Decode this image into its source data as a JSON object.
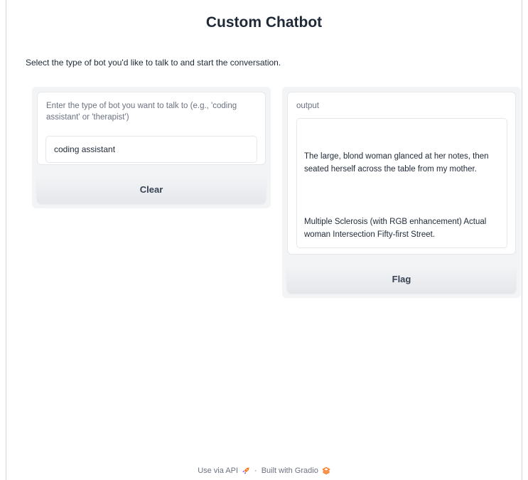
{
  "header": {
    "title": "Custom Chatbot",
    "description": "Select the type of bot you'd like to talk to and start the conversation."
  },
  "input_panel": {
    "label": "Enter the type of bot you want to talk to (e.g., 'coding assistant' or 'therapist')",
    "value": "coding assistant",
    "clear_label": "Clear"
  },
  "output_panel": {
    "label": "output",
    "paragraph1": "The large, blond woman glanced at her notes, then seated herself across the table from my mother.",
    "paragraph2": "Multiple Sclerosis (with RGB enhancement) Actual woman Intersection Fifty-first Street.",
    "flag_label": "Flag"
  },
  "footer": {
    "api_label": "Use via API",
    "separator": "·",
    "built_label": "Built with Gradio",
    "api_icon": "rocket-icon",
    "gradio_icon": "gradio-logo-icon",
    "accent_color": "#f97316"
  }
}
